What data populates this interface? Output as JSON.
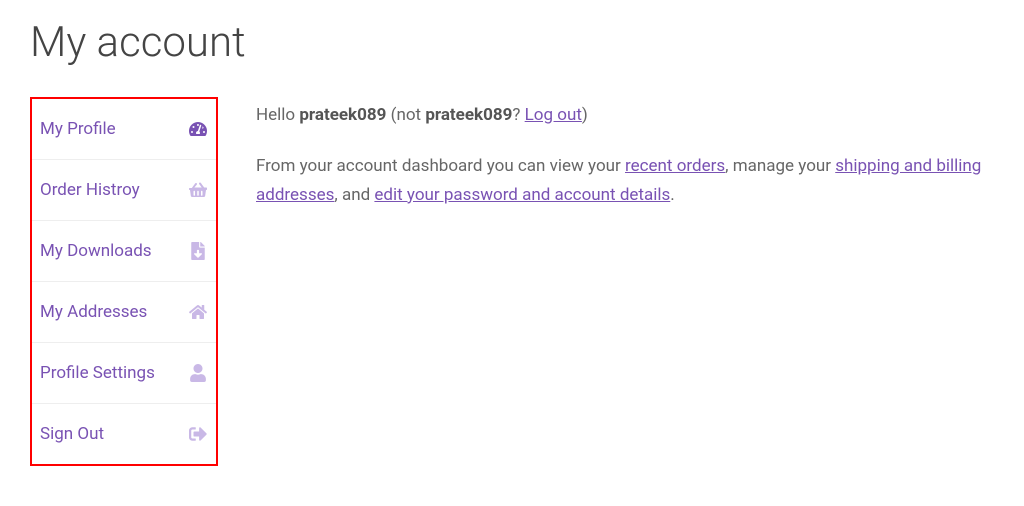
{
  "page": {
    "title": "My account"
  },
  "sidebar": {
    "items": [
      {
        "label": "My Profile",
        "icon": "dashboard-icon",
        "active": true
      },
      {
        "label": "Order Histroy",
        "icon": "basket-icon",
        "active": false
      },
      {
        "label": "My Downloads",
        "icon": "file-icon",
        "active": false
      },
      {
        "label": "My Addresses",
        "icon": "home-icon",
        "active": false
      },
      {
        "label": "Profile Settings",
        "icon": "user-icon",
        "active": false
      },
      {
        "label": "Sign Out",
        "icon": "signout-icon",
        "active": false
      }
    ]
  },
  "main": {
    "greeting": {
      "hello": "Hello ",
      "username": "prateek089",
      "not_prefix": " (not ",
      "not_username": "prateek089",
      "not_suffix": "? ",
      "logout_link": "Log out",
      "closing": ")"
    },
    "body": {
      "part1": "From your account dashboard you can view your ",
      "link1": "recent orders",
      "part2": ", manage your ",
      "link2": "shipping and billing addresses",
      "part3": ", and ",
      "link3": "edit your password and account details",
      "part4": "."
    }
  }
}
